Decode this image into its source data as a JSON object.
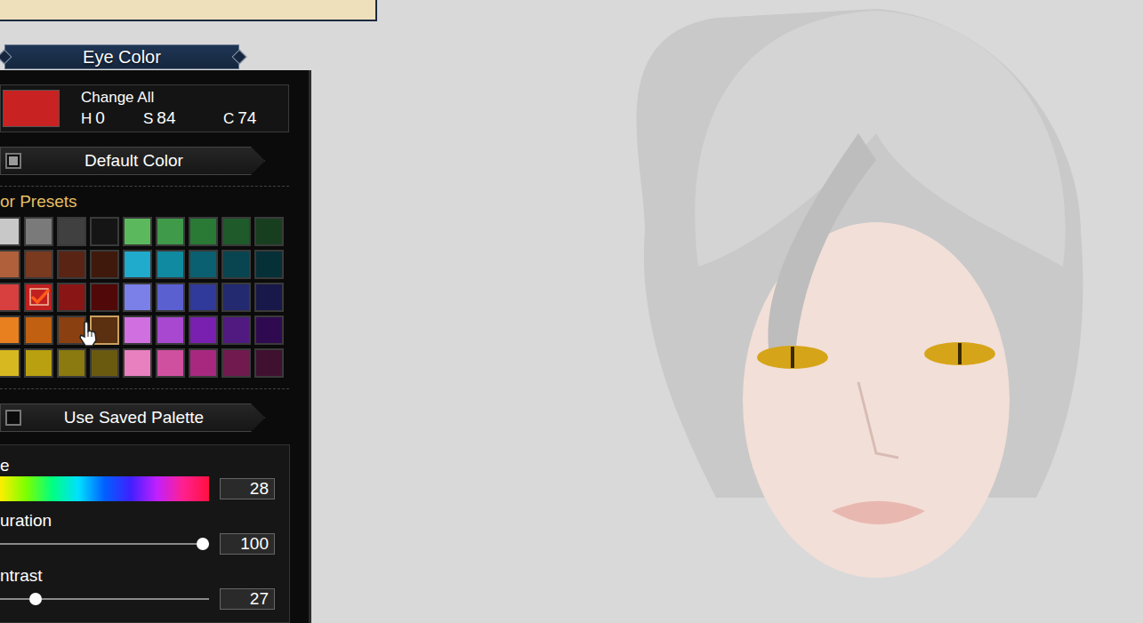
{
  "panel": {
    "title": "Eye Color"
  },
  "change_all": {
    "label": "Change All",
    "swatch": "#c82222",
    "values": [
      {
        "key": "H",
        "value": "0"
      },
      {
        "key": "S",
        "value": "84"
      },
      {
        "key": "C",
        "value": "74"
      }
    ]
  },
  "default_color": {
    "label": "Default Color",
    "checked": true
  },
  "presets": {
    "title": "or Presets",
    "swatches": [
      {
        "color": "#c8c8c8",
        "selected": false,
        "hovered": false
      },
      {
        "color": "#7a7a7a",
        "selected": false,
        "hovered": false
      },
      {
        "color": "#404040",
        "selected": false,
        "hovered": false
      },
      {
        "color": "#151515",
        "selected": false,
        "hovered": false
      },
      {
        "color": "#5cb85c",
        "selected": false,
        "hovered": false
      },
      {
        "color": "#3f9a4a",
        "selected": false,
        "hovered": false
      },
      {
        "color": "#2a7a35",
        "selected": false,
        "hovered": false
      },
      {
        "color": "#1e5a2a",
        "selected": false,
        "hovered": false
      },
      {
        "color": "#173f1f",
        "selected": false,
        "hovered": false
      },
      {
        "color": "#b0603a",
        "selected": false,
        "hovered": false
      },
      {
        "color": "#7a3a20",
        "selected": false,
        "hovered": false
      },
      {
        "color": "#5a2415",
        "selected": false,
        "hovered": false
      },
      {
        "color": "#3f1a0c",
        "selected": false,
        "hovered": false
      },
      {
        "color": "#20aacc",
        "selected": false,
        "hovered": false
      },
      {
        "color": "#108aa0",
        "selected": false,
        "hovered": false
      },
      {
        "color": "#0a6070",
        "selected": false,
        "hovered": false
      },
      {
        "color": "#084550",
        "selected": false,
        "hovered": false
      },
      {
        "color": "#063038",
        "selected": false,
        "hovered": false
      },
      {
        "color": "#d84040",
        "selected": false,
        "hovered": false
      },
      {
        "color": "#c02020",
        "selected": true,
        "hovered": false
      },
      {
        "color": "#8a1515",
        "selected": false,
        "hovered": false
      },
      {
        "color": "#500808",
        "selected": false,
        "hovered": false
      },
      {
        "color": "#7a80e8",
        "selected": false,
        "hovered": false
      },
      {
        "color": "#5a60d0",
        "selected": false,
        "hovered": false
      },
      {
        "color": "#303a9a",
        "selected": false,
        "hovered": false
      },
      {
        "color": "#232a70",
        "selected": false,
        "hovered": false
      },
      {
        "color": "#18184a",
        "selected": false,
        "hovered": false
      },
      {
        "color": "#e88020",
        "selected": false,
        "hovered": false
      },
      {
        "color": "#c06010",
        "selected": false,
        "hovered": false
      },
      {
        "color": "#8a4010",
        "selected": false,
        "hovered": false
      },
      {
        "color": "#5a3010",
        "selected": false,
        "hovered": true
      },
      {
        "color": "#d070e0",
        "selected": false,
        "hovered": false
      },
      {
        "color": "#a848d0",
        "selected": false,
        "hovered": false
      },
      {
        "color": "#7a20b0",
        "selected": false,
        "hovered": false
      },
      {
        "color": "#501a80",
        "selected": false,
        "hovered": false
      },
      {
        "color": "#300a50",
        "selected": false,
        "hovered": false
      },
      {
        "color": "#d8b820",
        "selected": false,
        "hovered": false
      },
      {
        "color": "#b8a010",
        "selected": false,
        "hovered": false
      },
      {
        "color": "#8a7a10",
        "selected": false,
        "hovered": false
      },
      {
        "color": "#6a5a10",
        "selected": false,
        "hovered": false
      },
      {
        "color": "#e880c0",
        "selected": false,
        "hovered": false
      },
      {
        "color": "#d050a0",
        "selected": false,
        "hovered": false
      },
      {
        "color": "#a82880",
        "selected": false,
        "hovered": false
      },
      {
        "color": "#701a50",
        "selected": false,
        "hovered": false
      },
      {
        "color": "#401030",
        "selected": false,
        "hovered": false
      }
    ]
  },
  "saved_palette": {
    "label": "Use Saved Palette",
    "checked": false
  },
  "sliders": [
    {
      "label": "e",
      "kind": "hue",
      "value": "28"
    },
    {
      "label": "uration",
      "kind": "slider",
      "level": 1,
      "value": "100"
    },
    {
      "label": "ntrast",
      "kind": "slider",
      "level": 0.17,
      "value": "27"
    }
  ]
}
